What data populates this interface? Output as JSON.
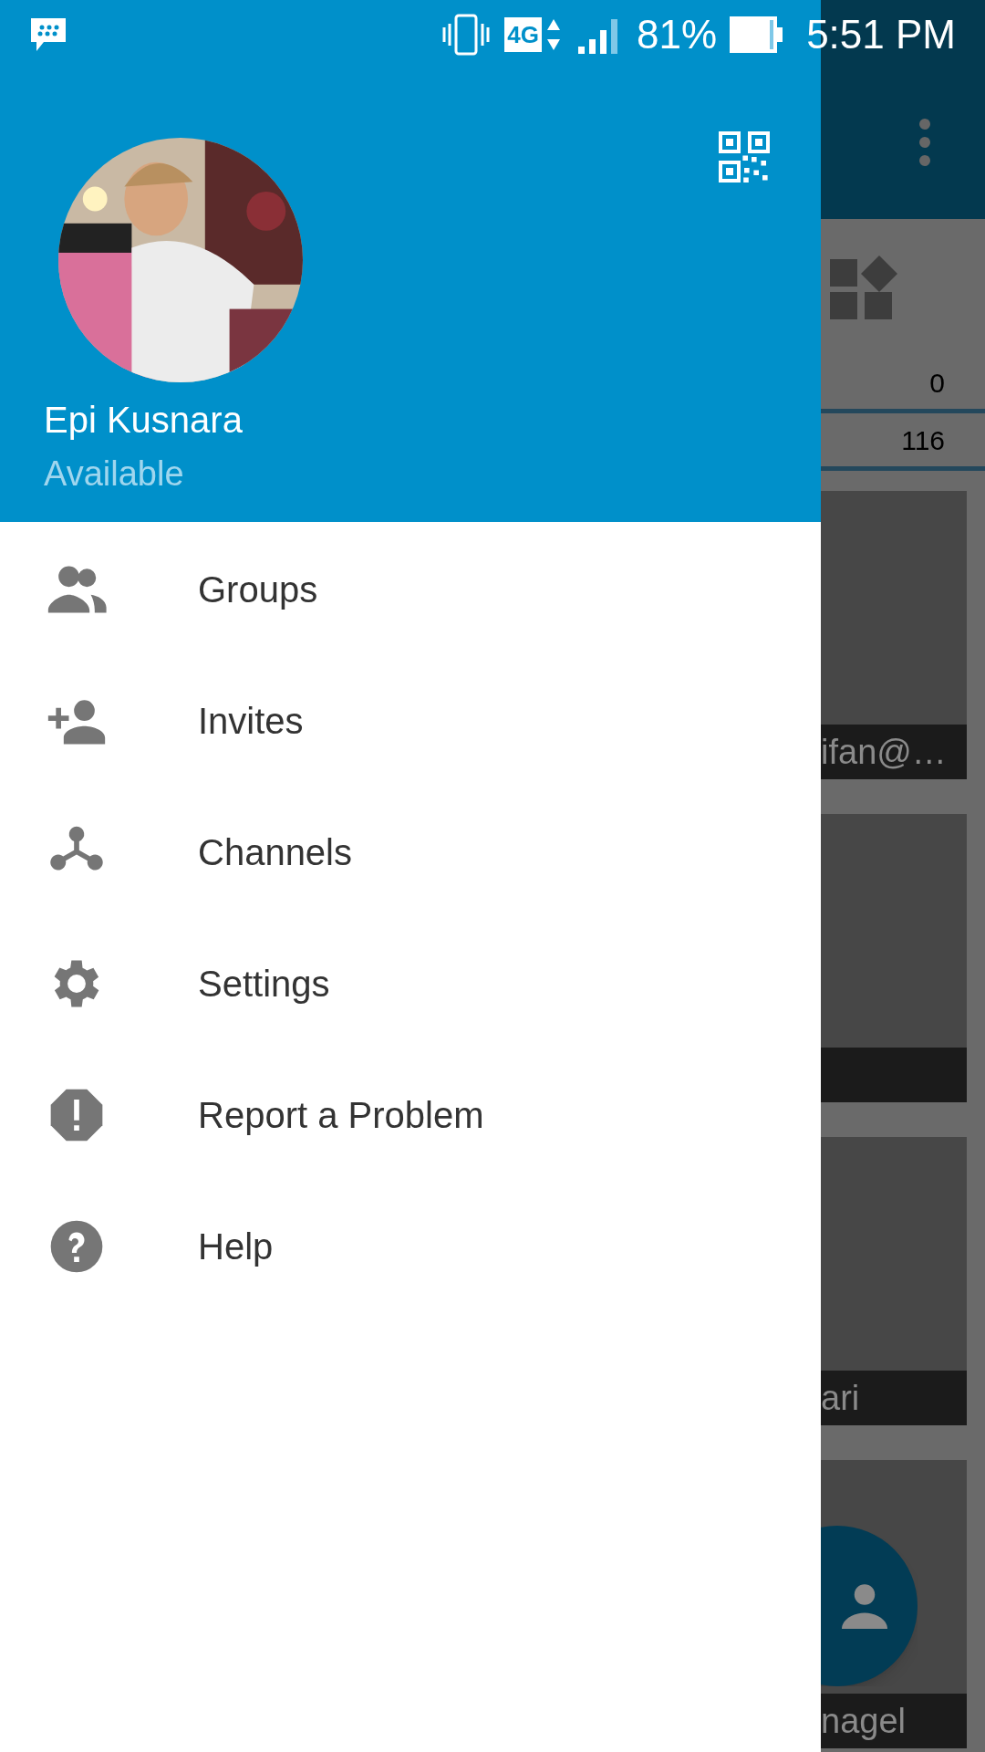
{
  "status_bar": {
    "battery": "81%",
    "time": "5:51 PM",
    "network": "4G"
  },
  "profile": {
    "name": "Epi Kusnara",
    "status": "Available"
  },
  "menu": [
    {
      "kind": "groups",
      "label": "Groups"
    },
    {
      "kind": "invites",
      "label": "Invites"
    },
    {
      "kind": "channels",
      "label": "Channels"
    },
    {
      "kind": "settings",
      "label": "Settings"
    },
    {
      "kind": "report",
      "label": "Report a Problem"
    },
    {
      "kind": "help",
      "label": "Help"
    }
  ],
  "background": {
    "counts": [
      "0",
      "116"
    ],
    "tiles": [
      {
        "kind": "contact",
        "label": "ifan@…"
      },
      {
        "kind": "contact"
      },
      {
        "kind": "contact",
        "label": "ari"
      },
      {
        "kind": "contact",
        "label": "nagel"
      }
    ]
  }
}
